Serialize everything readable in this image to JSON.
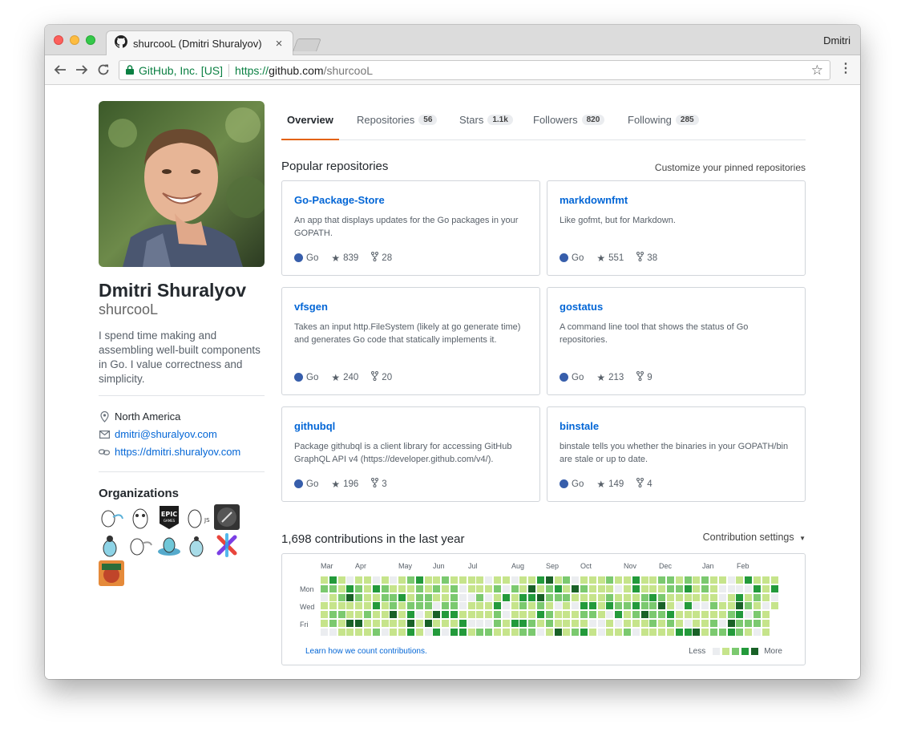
{
  "browser": {
    "tab_title": "shurcooL (Dmitri Shuralyov)",
    "profile_name": "Dmitri",
    "secure_label": "GitHub, Inc. [US]",
    "url_proto": "https://",
    "url_host": "github.com",
    "url_path": "/shurcooL"
  },
  "profile": {
    "full_name": "Dmitri Shuralyov",
    "login": "shurcooL",
    "bio": "I spend time making and assembling well-built components in Go. I value correctness and simplicity.",
    "location": "North America",
    "email": "dmitri@shuralyov.com",
    "website": "https://dmitri.shuralyov.com",
    "organizations_title": "Organizations"
  },
  "nav_tabs": [
    {
      "label": "Overview",
      "count": ""
    },
    {
      "label": "Repositories",
      "count": "56"
    },
    {
      "label": "Stars",
      "count": "1.1k"
    },
    {
      "label": "Followers",
      "count": "820"
    },
    {
      "label": "Following",
      "count": "285"
    }
  ],
  "popular": {
    "title": "Popular repositories",
    "customize": "Customize your pinned repositories",
    "repos": [
      {
        "name": "Go-Package-Store",
        "desc": "An app that displays updates for the Go packages in your GOPATH.",
        "lang": "Go",
        "stars": "839",
        "forks": "28"
      },
      {
        "name": "markdownfmt",
        "desc": "Like gofmt, but for Markdown.",
        "lang": "Go",
        "stars": "551",
        "forks": "38"
      },
      {
        "name": "vfsgen",
        "desc": "Takes an input http.FileSystem (likely at go generate time) and generates Go code that statically implements it.",
        "lang": "Go",
        "stars": "240",
        "forks": "20"
      },
      {
        "name": "gostatus",
        "desc": "A command line tool that shows the status of Go repositories.",
        "lang": "Go",
        "stars": "213",
        "forks": "9"
      },
      {
        "name": "githubql",
        "desc": "Package githubql is a client library for accessing GitHub GraphQL API v4 (https://developer.github.com/v4/).",
        "lang": "Go",
        "stars": "196",
        "forks": "3"
      },
      {
        "name": "binstale",
        "desc": "binstale tells you whether the binaries in your GOPATH/bin are stale or up to date.",
        "lang": "Go",
        "stars": "149",
        "forks": "4"
      }
    ]
  },
  "contributions": {
    "title": "1,698 contributions in the last year",
    "settings": "Contribution settings",
    "months": [
      "Mar",
      "Apr",
      "May",
      "Jun",
      "Jul",
      "Aug",
      "Sep",
      "Oct",
      "Nov",
      "Dec",
      "Jan",
      "Feb"
    ],
    "weekdays": [
      "Mon",
      "Wed",
      "Fri"
    ],
    "learn": "Learn how we count contributions.",
    "less": "Less",
    "more": "More",
    "colors": [
      "#ebedf0",
      "#c6e48b",
      "#7bc96f",
      "#239a3b",
      "#196127"
    ]
  },
  "colors": {
    "link": "#0366d6",
    "go_lang": "#375eab",
    "active_tab_underline": "#e36209"
  }
}
